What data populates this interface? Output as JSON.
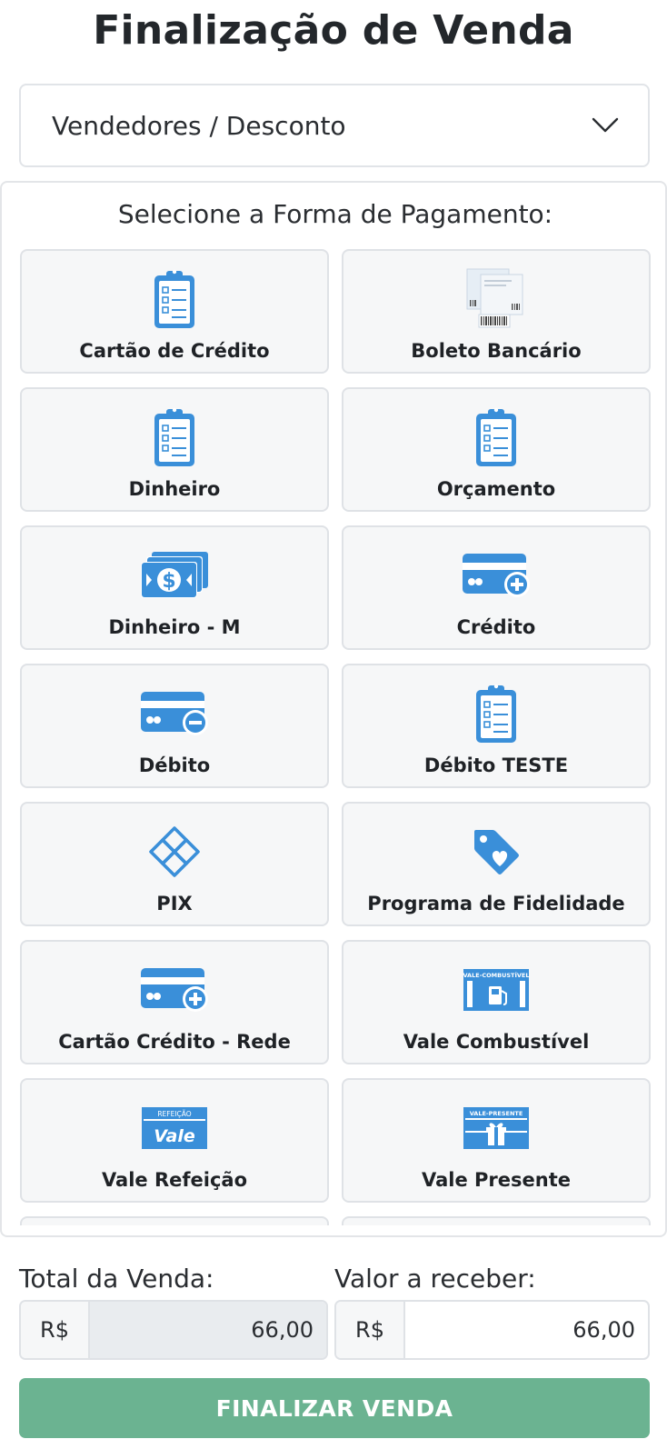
{
  "page": {
    "title": "Finalização de Venda"
  },
  "accordion": {
    "label": "Vendedores / Desconto",
    "icon": "chevron-down-icon"
  },
  "payment": {
    "title": "Selecione a Forma de Pagamento:",
    "options": [
      {
        "label": "Cartão de Crédito",
        "icon": "clipboard-checklist-icon"
      },
      {
        "label": "Boleto Bancário",
        "icon": "boleto-barcode-icon"
      },
      {
        "label": "Dinheiro",
        "icon": "clipboard-checklist-icon"
      },
      {
        "label": "Orçamento",
        "icon": "clipboard-checklist-icon"
      },
      {
        "label": "Dinheiro - M",
        "icon": "money-bills-icon"
      },
      {
        "label": "Crédito",
        "icon": "card-plus-icon"
      },
      {
        "label": "Débito",
        "icon": "card-minus-icon"
      },
      {
        "label": "Débito TESTE",
        "icon": "clipboard-checklist-icon"
      },
      {
        "label": "PIX",
        "icon": "pix-icon"
      },
      {
        "label": "Programa de Fidelidade",
        "icon": "tag-heart-icon"
      },
      {
        "label": "Cartão Crédito - Rede",
        "icon": "card-plus-icon"
      },
      {
        "label": "Vale Combustível",
        "icon": "fuel-voucher-icon"
      },
      {
        "label": "Vale Refeição",
        "icon": "meal-voucher-icon"
      },
      {
        "label": "Vale Presente",
        "icon": "gift-voucher-icon"
      }
    ],
    "voucher_texts": {
      "fuel": "VALE-COMBUSTÍVEL",
      "meal_top": "REFEIÇÃO",
      "meal_main": "Vale",
      "gift": "VALE-PRESENTE"
    }
  },
  "totals": {
    "total_label": "Total da Venda:",
    "total_prefix": "R$",
    "total_value": "66,00",
    "receive_label": "Valor a receber:",
    "receive_prefix": "R$",
    "receive_value": "66,00"
  },
  "actions": {
    "finalize_label": "FINALIZAR VENDA"
  },
  "colors": {
    "icon_blue": "#3a8fd9",
    "finalize_green": "#6bb391"
  }
}
